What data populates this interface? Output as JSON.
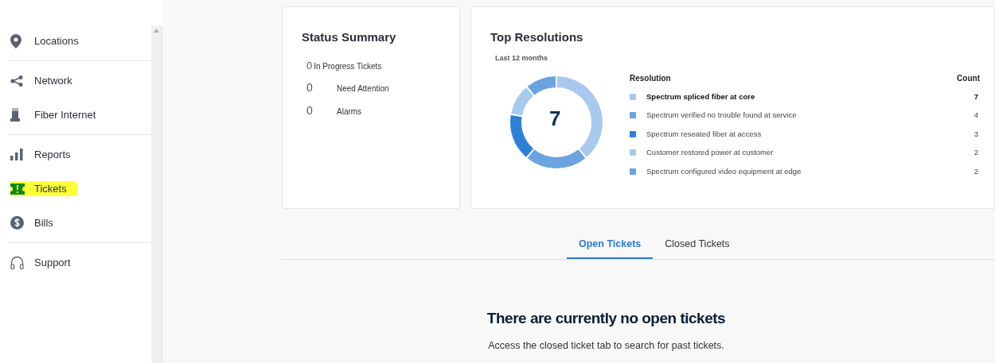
{
  "sidebar": {
    "items": [
      {
        "label": "Locations",
        "highlighted": false,
        "divider_after": true
      },
      {
        "label": "Network",
        "highlighted": false,
        "divider_after": false
      },
      {
        "label": "Fiber Internet",
        "highlighted": false,
        "divider_after": true
      },
      {
        "label": "Reports",
        "highlighted": false,
        "divider_after": false
      },
      {
        "label": "Tickets",
        "highlighted": true,
        "divider_after": false
      },
      {
        "label": "Bills",
        "highlighted": false,
        "divider_after": true
      },
      {
        "label": "Support",
        "highlighted": false,
        "divider_after": false
      }
    ]
  },
  "status_summary": {
    "title": "Status Summary",
    "rows": [
      {
        "count": "0",
        "label": "In Progress Tickets",
        "kind": "inline"
      },
      {
        "count": "0",
        "label": "Need Attention",
        "kind": "column"
      },
      {
        "count": "0",
        "label": "Alarms",
        "kind": "column"
      }
    ]
  },
  "top_resolutions": {
    "title": "Top Resolutions",
    "subtitle": "Last 12 months",
    "center_label": "7",
    "chart_data": {
      "type": "donut",
      "values": [
        38.9,
        22.2,
        16.7,
        11.1,
        11.1
      ]
    },
    "columns": [
      "Resolution",
      "Count"
    ],
    "rows": [
      {
        "resolution": "Spectrum spliced fiber at core",
        "count": "7",
        "color": "#a8c9ee",
        "bold": true
      },
      {
        "resolution": "Spectrum verified no trouble found at service",
        "count": "4",
        "color": "#6aa3e0",
        "bold": false
      },
      {
        "resolution": "Spectrum reseated fiber at access",
        "count": "3",
        "color": "#2e7fd6",
        "bold": false
      },
      {
        "resolution": "Customer restored power at customer",
        "count": "2",
        "color": "#a8c9ee",
        "bold": false
      },
      {
        "resolution": "Spectrum configured video equipment at edge",
        "count": "2",
        "color": "#6aa3e0",
        "bold": false
      }
    ]
  },
  "tabs": [
    {
      "label": "Open Tickets",
      "selected": true
    },
    {
      "label": "Closed Tickets",
      "selected": false
    }
  ],
  "empty_state": {
    "title": "There are currently no open tickets",
    "message": "Access the closed ticket tab to search for past tickets."
  }
}
